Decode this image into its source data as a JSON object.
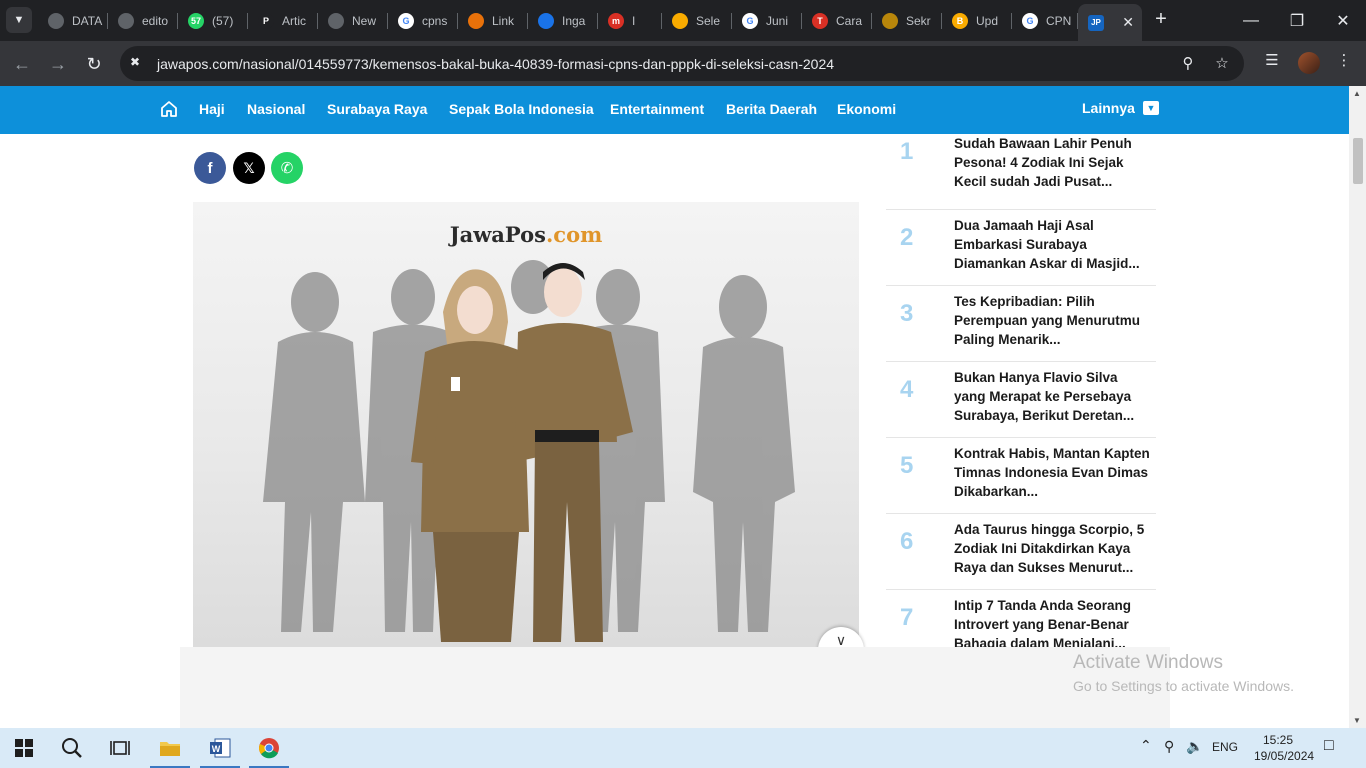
{
  "browser": {
    "tabs": [
      {
        "label": "DATA",
        "favicon": "globe-icon",
        "color": "#5f6368"
      },
      {
        "label": "edito",
        "favicon": "globe-icon",
        "color": "#5f6368"
      },
      {
        "label": "(57)",
        "favicon": "whatsapp-icon",
        "color": "#25d366",
        "badge": "57"
      },
      {
        "label": "Artic",
        "favicon": "p-icon",
        "color": "#202124",
        "badge": "P"
      },
      {
        "label": "New",
        "favicon": "chrome-icon",
        "color": "#5f6368"
      },
      {
        "label": "cpns",
        "favicon": "google-icon",
        "color": "#ffffff",
        "badge": "G"
      },
      {
        "label": "Link",
        "favicon": "nbc-icon",
        "color": "#e8710a"
      },
      {
        "label": "Inga",
        "favicon": "nbc-icon",
        "color": "#1a73e8"
      },
      {
        "label": "I",
        "favicon": "m-icon",
        "color": "#d93025",
        "badge": "m"
      },
      {
        "label": "Sele",
        "favicon": "logo-icon",
        "color": "#f9ab00"
      },
      {
        "label": "Juni",
        "favicon": "google-icon",
        "color": "#ffffff",
        "badge": "G"
      },
      {
        "label": "Cara",
        "favicon": "t-icon",
        "color": "#d93025",
        "badge": "T"
      },
      {
        "label": "Sekr",
        "favicon": "garuda-icon",
        "color": "#b8860b"
      },
      {
        "label": "Upd",
        "favicon": "b-icon",
        "color": "#f9ab00",
        "badge": "B"
      },
      {
        "label": "CPN",
        "favicon": "google-icon",
        "color": "#ffffff",
        "badge": "G"
      }
    ],
    "active_tab": {
      "favicon": "jp-icon",
      "badge": "JP"
    },
    "url": "jawapos.com/nasional/014559773/kemensos-bakal-buka-40839-formasi-cpns-dan-pppk-di-seleksi-casn-2024"
  },
  "site_nav": {
    "links": [
      "Haji",
      "Nasional",
      "Surabaya Raya",
      "Sepak Bola Indonesia",
      "Entertainment",
      "Berita Daerah",
      "Ekonomi"
    ],
    "more": "Lainnya"
  },
  "hero": {
    "brand_main": "JawaPos",
    "brand_suffix": ".com"
  },
  "trending": [
    {
      "rank": "1",
      "title": "Sudah Bawaan Lahir Penuh Pesona! 4 Zodiak Ini Sejak Kecil sudah Jadi Pusat..."
    },
    {
      "rank": "2",
      "title": "Dua Jamaah Haji Asal Embarkasi Surabaya Diamankan Askar di Masjid..."
    },
    {
      "rank": "3",
      "title": "Tes Kepribadian: Pilih Perempuan yang Menurutmu Paling Menarik..."
    },
    {
      "rank": "4",
      "title": "Bukan Hanya Flavio Silva yang Merapat ke Persebaya Surabaya, Berikut Deretan..."
    },
    {
      "rank": "5",
      "title": "Kontrak Habis, Mantan Kapten Timnas Indonesia Evan Dimas Dikabarkan..."
    },
    {
      "rank": "6",
      "title": "Ada Taurus hingga Scorpio, 5 Zodiak Ini Ditakdirkan Kaya Raya dan Sukses Menurut..."
    },
    {
      "rank": "7",
      "title": "Intip 7 Tanda Anda Seorang Introvert yang Benar-Benar Bahagia dalam Menjalani..."
    }
  ],
  "watermark": {
    "line1": "Activate Windows",
    "line2": "Go to Settings to activate Windows."
  },
  "taskbar": {
    "language": "ENG",
    "time": "15:25",
    "date": "19/05/2024"
  }
}
